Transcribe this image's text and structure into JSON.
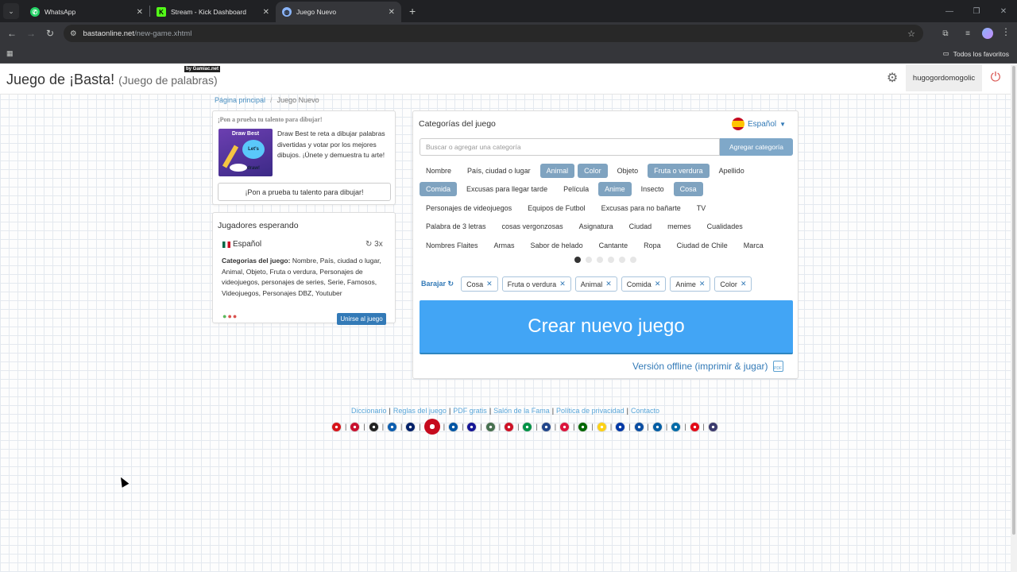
{
  "browser": {
    "tabs": [
      {
        "title": "WhatsApp",
        "icon": "whatsapp-icon",
        "color": "#25d366"
      },
      {
        "title": "Stream - Kick Dashboard",
        "icon": "kick-icon",
        "color": "#53fc18"
      },
      {
        "title": "Juego Nuevo",
        "icon": "globe-icon",
        "color": "#8ab4f8"
      }
    ],
    "url_host": "bastaonline.net",
    "url_path": "/new-game.xhtml",
    "bookmarks_folder": "Todos los favoritos"
  },
  "header": {
    "title": "Juego de ¡Basta!",
    "subtitle": "(Juego de palabras)",
    "badge": "by Gamiac.net",
    "username": "hugogordomogolic"
  },
  "breadcrumb": {
    "home": "Página principal",
    "current": "Juego Nuevo"
  },
  "ad": {
    "heading": "¡Pon a prueba tu talento para dibujar!",
    "image_title": "Draw Best",
    "image_bubble": "Let's draw!",
    "text": "Draw Best te reta a dibujar palabras divertidas y votar por los mejores dibujos. ¡Únete y demuestra tu arte!",
    "button": "¡Pon a prueba tu talento para dibujar!"
  },
  "players": {
    "title": "Jugadores esperando",
    "language": "Español",
    "rounds": "3x",
    "categories_label": "Categorias del juego:",
    "categories_text": "Nombre, País, ciudad o lugar, Animal, Objeto, Fruta o verdura, Personajes de videojuegos, personajes de series, Serie, Famosos, Videojuegos, Personajes DBZ, Youtuber",
    "join_button": "Unirse al juego"
  },
  "categories": {
    "title": "Categorías del juego",
    "language": "Español",
    "search_placeholder": "Buscar o agregar una categoría",
    "add_button": "Agregar categoría",
    "rows": [
      [
        {
          "label": "Nombre",
          "sel": false
        },
        {
          "label": "País, ciudad o lugar",
          "sel": false
        },
        {
          "label": "Animal",
          "sel": true
        },
        {
          "label": "Color",
          "sel": true
        },
        {
          "label": "Objeto",
          "sel": false
        },
        {
          "label": "Fruta o verdura",
          "sel": true
        },
        {
          "label": "Apellido",
          "sel": false
        }
      ],
      [
        {
          "label": "Comida",
          "sel": true
        },
        {
          "label": "Excusas para llegar tarde",
          "sel": false
        },
        {
          "label": "Película",
          "sel": false
        },
        {
          "label": "Anime",
          "sel": true
        },
        {
          "label": "Insecto",
          "sel": false
        },
        {
          "label": "Cosa",
          "sel": true
        }
      ],
      [
        {
          "label": "Personajes de videojuegos",
          "sel": false
        },
        {
          "label": "Equipos de Futbol",
          "sel": false
        },
        {
          "label": "Excusas para no bañarte",
          "sel": false
        },
        {
          "label": "TV",
          "sel": false
        }
      ],
      [
        {
          "label": "Palabra de 3 letras",
          "sel": false
        },
        {
          "label": "cosas vergonzosas",
          "sel": false
        },
        {
          "label": "Asignatura",
          "sel": false
        },
        {
          "label": "Ciudad",
          "sel": false
        },
        {
          "label": "memes",
          "sel": false
        },
        {
          "label": "Cualidades",
          "sel": false
        }
      ],
      [
        {
          "label": "Nombres Flaites",
          "sel": false
        },
        {
          "label": "Armas",
          "sel": false
        },
        {
          "label": "Sabor de helado",
          "sel": false
        },
        {
          "label": "Cantante",
          "sel": false
        },
        {
          "label": "Ropa",
          "sel": false
        },
        {
          "label": "Ciudad de Chile",
          "sel": false
        },
        {
          "label": "Marca",
          "sel": false
        }
      ]
    ],
    "page_dots": 6,
    "active_dot": 0,
    "shuffle_label": "Barajar",
    "selected": [
      "Cosa",
      "Fruta o verdura",
      "Animal",
      "Comida",
      "Anime",
      "Color"
    ],
    "create_button": "Crear nuevo juego",
    "offline_link": "Versión offline (imprimir & jugar)",
    "pdf_label": "PDF"
  },
  "footer": {
    "links": [
      "Diccionario",
      "Reglas del juego",
      "PDF gratis",
      "Salón de la Fama",
      "Política de privacidad",
      "Contacto"
    ],
    "flags": [
      {
        "name": "czech",
        "c": "#d7141a",
        "big": false
      },
      {
        "name": "danish",
        "c": "#c8102e",
        "big": false
      },
      {
        "name": "german",
        "c": "#222222",
        "big": false
      },
      {
        "name": "greek",
        "c": "#0d5eaf",
        "big": false
      },
      {
        "name": "english",
        "c": "#012169",
        "big": false
      },
      {
        "name": "spanish",
        "c": "#c60b1e",
        "big": true
      },
      {
        "name": "french",
        "c": "#0055a4",
        "big": false
      },
      {
        "name": "croatian",
        "c": "#171796",
        "big": false
      },
      {
        "name": "hungarian",
        "c": "#477050",
        "big": false
      },
      {
        "name": "indonesian",
        "c": "#ce1126",
        "big": false
      },
      {
        "name": "italian",
        "c": "#009246",
        "big": false
      },
      {
        "name": "dutch",
        "c": "#21468b",
        "big": false
      },
      {
        "name": "polish",
        "c": "#dc143c",
        "big": false
      },
      {
        "name": "portuguese",
        "c": "#006600",
        "big": false
      },
      {
        "name": "romanian",
        "c": "#fcd116",
        "big": false
      },
      {
        "name": "russian",
        "c": "#0039a6",
        "big": false
      },
      {
        "name": "slovak",
        "c": "#0b4ea2",
        "big": false
      },
      {
        "name": "slovenian",
        "c": "#005da4",
        "big": false
      },
      {
        "name": "swedish",
        "c": "#006aa7",
        "big": false
      },
      {
        "name": "turkish",
        "c": "#e30a17",
        "big": false
      },
      {
        "name": "american",
        "c": "#3c3b6e",
        "big": false
      }
    ]
  }
}
